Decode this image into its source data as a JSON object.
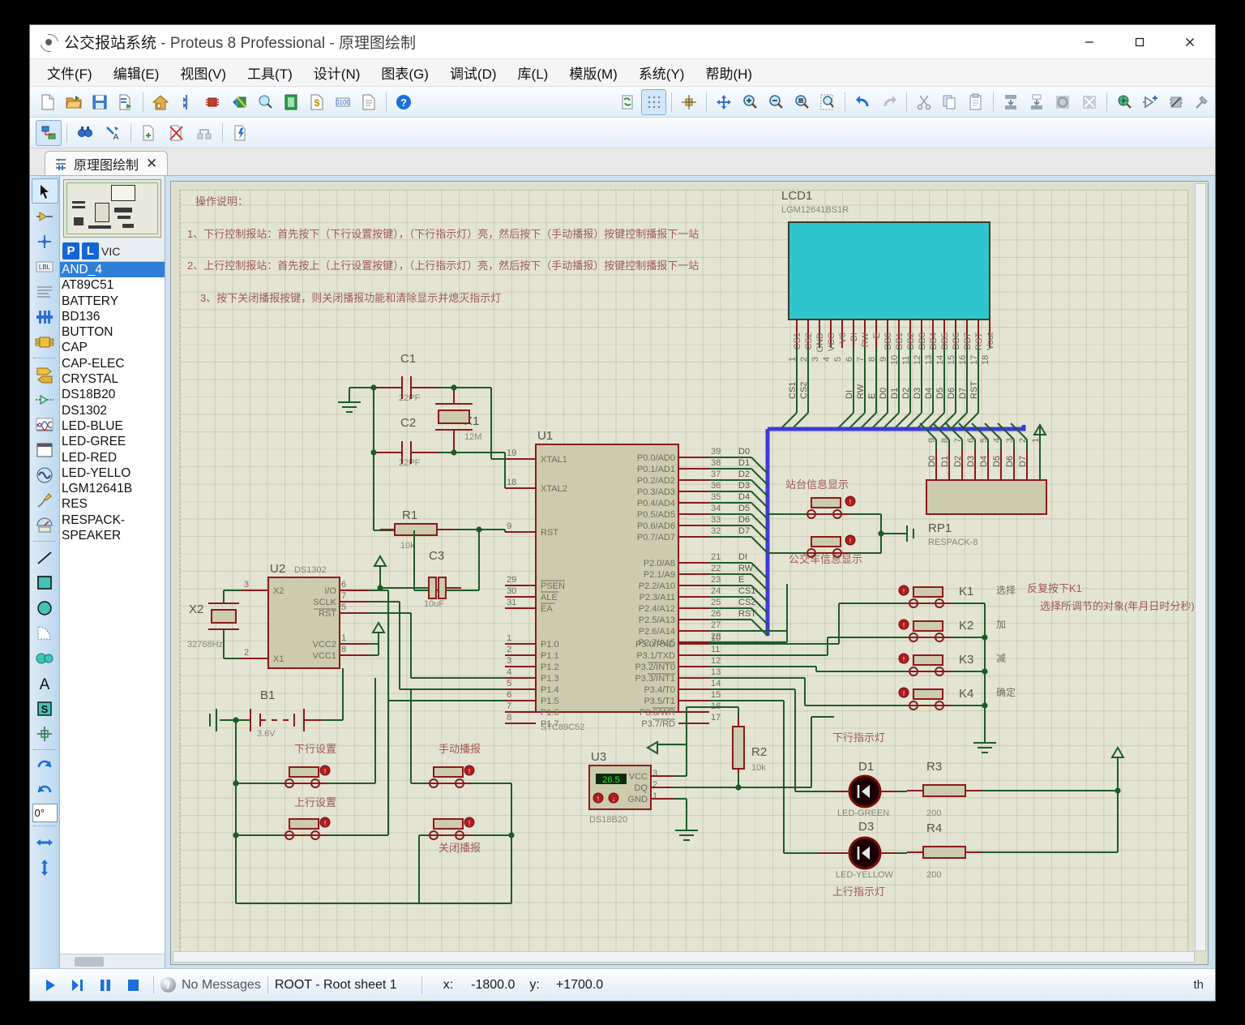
{
  "window": {
    "title_doc": "公交报站系统",
    "title_app": " - Proteus 8 Professional - ",
    "title_mode": "原理图绘制",
    "minimize": "—",
    "maximize": "▢",
    "close": "✕"
  },
  "menu": {
    "items": [
      {
        "label": "文件(F)",
        "name": "menu-file"
      },
      {
        "label": "编辑(E)",
        "name": "menu-edit"
      },
      {
        "label": "视图(V)",
        "name": "menu-view"
      },
      {
        "label": "工具(T)",
        "name": "menu-tool"
      },
      {
        "label": "设计(N)",
        "name": "menu-design"
      },
      {
        "label": "图表(G)",
        "name": "menu-graph"
      },
      {
        "label": "调试(D)",
        "name": "menu-debug"
      },
      {
        "label": "库(L)",
        "name": "menu-library"
      },
      {
        "label": "模版(M)",
        "name": "menu-template"
      },
      {
        "label": "系统(Y)",
        "name": "menu-system"
      },
      {
        "label": "帮助(H)",
        "name": "menu-help"
      }
    ]
  },
  "toolbar": {
    "row1_icons": [
      "new-file-icon",
      "open-folder-icon",
      "save-icon",
      "export-icon",
      "home-icon",
      "bill-of-materials-icon",
      "design-explorer-icon",
      "back-annotate-icon",
      "search-design-icon",
      "pcb-layout-icon",
      "bom-cost-icon",
      "visual-designer-icon",
      "report-icon",
      "help-icon"
    ],
    "row1_right_icons": [
      "refresh-icon",
      "grid-toggle-icon",
      "origin-icon",
      "pan-icon",
      "zoom-in-icon",
      "zoom-out-icon",
      "zoom-area-icon",
      "zoom-sheet-icon",
      "undo-icon",
      "redo-icon",
      "cut-icon",
      "copy-icon",
      "paste-icon",
      "block-copy-icon",
      "block-move-icon",
      "block-rotate-icon",
      "block-delete-icon",
      "pick-device-icon",
      "make-device-icon",
      "packaging-tool-icon",
      "decompose-icon"
    ],
    "row2_icons": [
      "schematic-capture-icon",
      "find-icon",
      "property-assignment-icon",
      "new-sheet-icon",
      "remove-sheet-icon",
      "goto-sheet-icon",
      "design-notes-icon"
    ]
  },
  "tab": {
    "label": "原理图绘制",
    "close": "✕",
    "icon": "schematic-icon"
  },
  "left_tools": {
    "items": [
      {
        "name": "selection-mode-icon",
        "selected": true
      },
      {
        "name": "component-mode-icon",
        "selected": false
      },
      {
        "name": "junction-dot-mode-icon",
        "selected": false
      },
      {
        "name": "wire-label-mode-icon",
        "selected": false
      },
      {
        "name": "text-script-mode-icon",
        "selected": false
      },
      {
        "name": "bus-mode-icon",
        "selected": false
      },
      {
        "name": "subcircuit-mode-icon",
        "selected": false
      },
      {
        "name": "terminals-mode-icon",
        "selected": false
      },
      {
        "name": "device-pin-mode-icon",
        "selected": false
      },
      {
        "name": "graph-mode-icon",
        "selected": false
      },
      {
        "name": "tape-recorder-mode-icon",
        "selected": false
      },
      {
        "name": "generator-mode-icon",
        "selected": false
      },
      {
        "name": "voltage-probe-mode-icon",
        "selected": false
      },
      {
        "name": "virtual-instrument-mode-icon",
        "selected": false
      },
      {
        "name": "line-tool-icon",
        "selected": false
      },
      {
        "name": "box-tool-icon",
        "selected": false
      },
      {
        "name": "circle-tool-icon",
        "selected": false
      },
      {
        "name": "arc-tool-icon",
        "selected": false
      },
      {
        "name": "path-tool-icon",
        "selected": false
      },
      {
        "name": "text-tool-icon",
        "selected": false
      },
      {
        "name": "symbol-tool-icon",
        "selected": false
      },
      {
        "name": "marker-tool-icon",
        "selected": false
      }
    ],
    "rotate_cw": "rotate-clockwise-icon",
    "rotate_ccw": "rotate-counterclockwise-icon",
    "rotation_value": "0°",
    "mirror_x": "mirror-horizontal-icon",
    "mirror_y": "mirror-vertical-icon"
  },
  "panel": {
    "pl_p": "P",
    "pl_l": "L",
    "pl_label": "VIC",
    "components": [
      "AND_4",
      "AT89C51",
      "BATTERY",
      "BD136",
      "BUTTON",
      "CAP",
      "CAP-ELEC",
      "CRYSTAL",
      "DS18B20",
      "DS1302",
      "LED-BLUE",
      "LED-GREE",
      "LED-RED",
      "LED-YELLO",
      "LGM12641B",
      "RES",
      "RESPACK-",
      "SPEAKER"
    ],
    "selected_index": 0
  },
  "statusbar": {
    "play": "play-icon",
    "step": "step-icon",
    "pause": "pause-icon",
    "stop": "stop-icon",
    "messages": "No Messages",
    "sheet": "ROOT - Root sheet 1",
    "x_label": "x:",
    "x_value": "-1800.0",
    "y_label": "y:",
    "y_value": "+1700.0",
    "right_text": "th"
  },
  "schematic": {
    "notes": {
      "heading": "操作说明：",
      "line1": "1、下行控制报站：首先按下（下行设置按键），（下行指示灯）亮，然后按下（手动播报）按键控制播报下一站",
      "line2": "2、上行控制报站：首先按上（上行设置按键），（上行指示灯）亮，然后按下（手动播报）按键控制播报下一站",
      "line3": "3、按下关闭播报按键，则关闭播报功能和清除显示并熄灭指示灯"
    },
    "lcd": {
      "ref": "LCD1",
      "part": "LGM12641BS1R",
      "pin_names": [
        "CS1",
        "CS2",
        "GND",
        "VCC",
        "V0",
        "DI",
        "RW",
        "E",
        "DB0",
        "DB1",
        "DB2",
        "DB3",
        "DB4",
        "DB5",
        "DB6",
        "DB7",
        "RST",
        "Vout"
      ],
      "pin_numbers": [
        "1",
        "2",
        "3",
        "4",
        "5",
        "6",
        "7",
        "8",
        "9",
        "10",
        "11",
        "12",
        "13",
        "14",
        "15",
        "16",
        "17",
        "18"
      ],
      "net_labels": [
        "CS1",
        "CS2",
        "",
        "",
        "",
        "DI",
        "RW",
        "E",
        "D0",
        "D1",
        "D2",
        "D3",
        "D4",
        "D5",
        "D6",
        "D7",
        "RST",
        ""
      ]
    },
    "rp1": {
      "ref": "RP1",
      "part": "RESPACK-8",
      "top_labels": [
        "D0",
        "D1",
        "D2",
        "D3",
        "D4",
        "D5",
        "D6",
        "D7"
      ],
      "pin_numbers": [
        "9",
        "8",
        "7",
        "6",
        "5",
        "4",
        "3",
        "2",
        "1"
      ]
    },
    "u1": {
      "ref": "U1",
      "part": "STC89C52",
      "left_pins": [
        {
          "num": "19",
          "name": "XTAL1"
        },
        {
          "num": "18",
          "name": "XTAL2"
        },
        {
          "num": "9",
          "name": "RST"
        },
        {
          "num": "29",
          "name": "PSEN"
        },
        {
          "num": "30",
          "name": "ALE"
        },
        {
          "num": "31",
          "name": "EA"
        },
        {
          "num": "1",
          "name": "P1.0"
        },
        {
          "num": "2",
          "name": "P1.1"
        },
        {
          "num": "3",
          "name": "P1.2"
        },
        {
          "num": "4",
          "name": "P1.3"
        },
        {
          "num": "5",
          "name": "P1.4"
        },
        {
          "num": "6",
          "name": "P1.5"
        },
        {
          "num": "7",
          "name": "P1.6"
        },
        {
          "num": "8",
          "name": "P1.7"
        }
      ],
      "right_p0": [
        {
          "num": "39",
          "name": "P0.0/AD0",
          "net": "D0"
        },
        {
          "num": "38",
          "name": "P0.1/AD1",
          "net": "D1"
        },
        {
          "num": "37",
          "name": "P0.2/AD2",
          "net": "D2"
        },
        {
          "num": "36",
          "name": "P0.3/AD3",
          "net": "D3"
        },
        {
          "num": "35",
          "name": "P0.4/AD4",
          "net": "D4"
        },
        {
          "num": "34",
          "name": "P0.5/AD5",
          "net": "D5"
        },
        {
          "num": "33",
          "name": "P0.6/AD6",
          "net": "D6"
        },
        {
          "num": "32",
          "name": "P0.7/AD7",
          "net": "D7"
        }
      ],
      "right_p2": [
        {
          "num": "21",
          "name": "P2.0/A8",
          "net": "DI"
        },
        {
          "num": "22",
          "name": "P2.1/A9",
          "net": "RW"
        },
        {
          "num": "23",
          "name": "P2.2/A10",
          "net": "E"
        },
        {
          "num": "24",
          "name": "P2.3/A11",
          "net": "CS1"
        },
        {
          "num": "25",
          "name": "P2.4/A12",
          "net": "CS2"
        },
        {
          "num": "26",
          "name": "P2.5/A13",
          "net": "RST"
        },
        {
          "num": "27",
          "name": "P2.6/A14",
          "net": ""
        },
        {
          "num": "28",
          "name": "P2.7/A15",
          "net": ""
        }
      ],
      "right_p3": [
        {
          "num": "10",
          "name": "P3.0/RXD"
        },
        {
          "num": "11",
          "name": "P3.1/TXD"
        },
        {
          "num": "12",
          "name": "P3.2/INT0"
        },
        {
          "num": "13",
          "name": "P3.3/INT1"
        },
        {
          "num": "14",
          "name": "P3.4/T0"
        },
        {
          "num": "15",
          "name": "P3.5/T1"
        },
        {
          "num": "16",
          "name": "P3.6/WR"
        },
        {
          "num": "17",
          "name": "P3.7/RD"
        }
      ]
    },
    "u2": {
      "ref": "U2",
      "part": "DS1302",
      "left_pins": [
        {
          "num": "3",
          "name": "X2"
        },
        {
          "num": "2",
          "name": "X1"
        }
      ],
      "right_pins": [
        {
          "num": "6",
          "name": "I/O"
        },
        {
          "num": "7",
          "name": "SCLK"
        },
        {
          "num": "5",
          "name": "RST"
        },
        {
          "num": "1",
          "name": "VCC2"
        },
        {
          "num": "8",
          "name": "VCC1"
        }
      ]
    },
    "u3": {
      "ref": "U3",
      "part": "DS18B20",
      "display": "26.5",
      "pins": [
        {
          "num": "3",
          "name": "VCC"
        },
        {
          "num": "2",
          "name": "DQ"
        },
        {
          "num": "1",
          "name": "GND"
        }
      ]
    },
    "passives": [
      {
        "ref": "C1",
        "value": "22PF"
      },
      {
        "ref": "C2",
        "value": "22PF"
      },
      {
        "ref": "C3",
        "value": "10uF"
      },
      {
        "ref": "X1",
        "value": "12M"
      },
      {
        "ref": "X2",
        "value": "32768Hz"
      },
      {
        "ref": "R1",
        "value": "10k"
      },
      {
        "ref": "R2",
        "value": "10k"
      },
      {
        "ref": "R3",
        "value": "200"
      },
      {
        "ref": "R4",
        "value": "200"
      },
      {
        "ref": "B1",
        "value": "3.6V"
      }
    ],
    "leds": [
      {
        "ref": "D1",
        "part": "LED-GREEN",
        "caption": "下行指示灯"
      },
      {
        "ref": "D3",
        "part": "LED-YELLOW",
        "caption": "上行指示灯"
      }
    ],
    "buttons_left": [
      {
        "caption": "下行设置"
      },
      {
        "caption": "上行设置"
      },
      {
        "caption": "手动播报"
      },
      {
        "caption": "关闭播报"
      }
    ],
    "buttons_info": [
      {
        "caption": "站台信息显示"
      },
      {
        "caption": "公交车信息显示"
      }
    ],
    "keys": [
      {
        "ref": "K1",
        "caption": "选择"
      },
      {
        "ref": "K2",
        "caption": "加"
      },
      {
        "ref": "K3",
        "caption": "减"
      },
      {
        "ref": "K4",
        "caption": "确定"
      }
    ],
    "key_note_line1": "反复按下K1",
    "key_note_line2": "选择所调节的对象(年月日时分秒)"
  },
  "colors": {
    "wire_green": "#1d5c28",
    "pin_red": "#8b1a1a",
    "body_fill": "#cdcbae",
    "lcd_screen": "#2ec5ce",
    "note_red": "#9e5a55",
    "sheet_bg": "#e4e4d2",
    "accent_blue": "#2f7fd8",
    "bus_blue": "#3b3bd6"
  }
}
